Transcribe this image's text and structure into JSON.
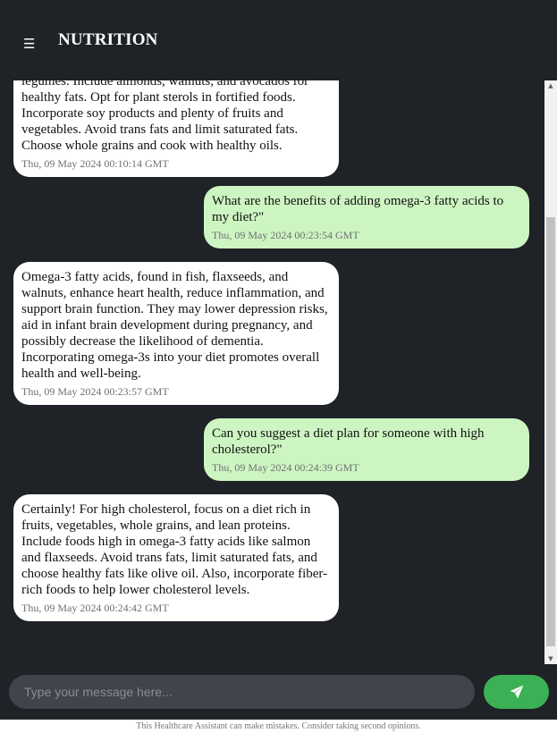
{
  "header": {
    "menu_icon": "☰",
    "title": "NUTRITION"
  },
  "messages": [
    {
      "role": "bot",
      "text": "legumes. Include almonds, walnuts, and avocados for healthy fats. Opt for plant sterols in fortified foods. Incorporate soy products and plenty of fruits and vegetables. Avoid trans fats and limit saturated fats. Choose whole grains and cook with healthy oils.",
      "time": "Thu, 09 May 2024 00:10:14 GMT"
    },
    {
      "role": "user",
      "text": "What are the benefits of adding omega-3 fatty acids to my diet?\"",
      "time": "Thu, 09 May 2024 00:23:54 GMT"
    },
    {
      "role": "bot",
      "text": "Omega-3 fatty acids, found in fish, flaxseeds, and walnuts, enhance heart health, reduce inflammation, and support brain function. They may lower depression risks, aid in infant brain development during pregnancy, and possibly decrease the likelihood of dementia. Incorporating omega-3s into your diet promotes overall health and well-being.",
      "time": "Thu, 09 May 2024 00:23:57 GMT"
    },
    {
      "role": "user",
      "text": "Can you suggest a diet plan for someone with high cholesterol?\"",
      "time": "Thu, 09 May 2024 00:24:39 GMT"
    },
    {
      "role": "bot",
      "text": "Certainly! For high cholesterol, focus on a diet rich in fruits, vegetables, whole grains, and lean proteins. Include foods high in omega-3 fatty acids like salmon and flaxseeds. Avoid trans fats, limit saturated fats, and choose healthy fats like olive oil. Also, incorporate fiber-rich foods to help lower cholesterol levels.",
      "time": "Thu, 09 May 2024 00:24:42 GMT"
    }
  ],
  "input": {
    "placeholder": "Type your message here...",
    "value": ""
  },
  "send_button": {
    "icon": "paper-plane-icon"
  },
  "footer": {
    "disclaimer": "This Healthcare Assistant can make mistakes. Consider taking second opinions."
  },
  "colors": {
    "background": "#1f2226",
    "bot_bubble": "#ffffff",
    "user_bubble": "#cdf5c2",
    "send_button": "#3cb054",
    "input_bg": "#40444b"
  }
}
